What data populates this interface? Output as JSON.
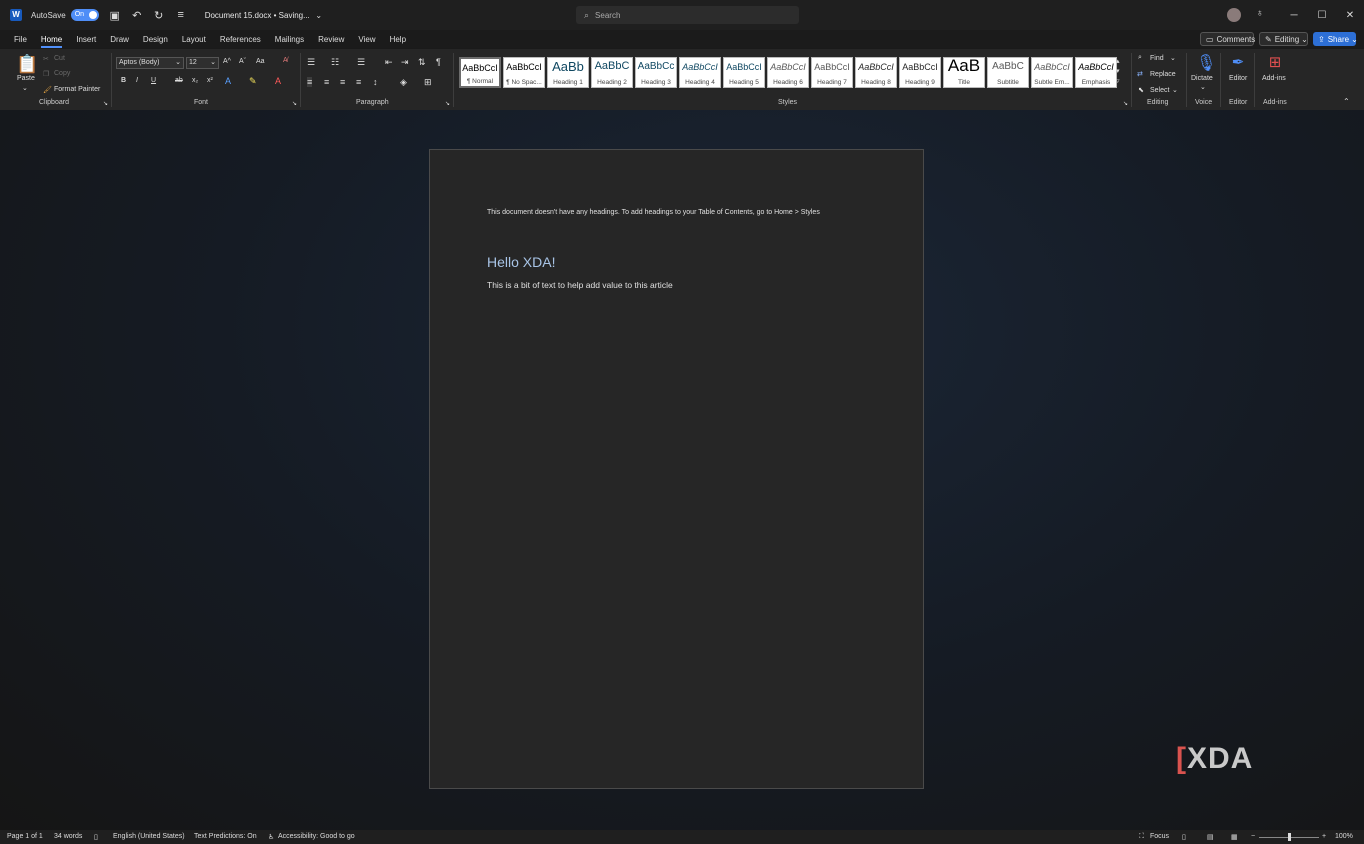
{
  "titlebar": {
    "app_icon": "word-icon",
    "autosave_label": "AutoSave",
    "autosave_state": "On",
    "doc_title": "Document 15.docx • Saving...",
    "search_placeholder": "Search",
    "window_controls": [
      "minimize-icon",
      "maximize-icon",
      "close-icon"
    ]
  },
  "tabs": [
    "File",
    "Home",
    "Insert",
    "Draw",
    "Design",
    "Layout",
    "References",
    "Mailings",
    "Review",
    "View",
    "Help"
  ],
  "active_tab": "Home",
  "top_right": {
    "comments_label": "Comments",
    "editing_label": "Editing",
    "share_label": "Share"
  },
  "ribbon": {
    "clipboard": {
      "label": "Clipboard",
      "paste": "Paste",
      "cut": "Cut",
      "copy": "Copy",
      "format_painter": "Format Painter"
    },
    "font": {
      "label": "Font",
      "font_name": "Aptos (Body)",
      "font_size": "12",
      "change_case": "Aa",
      "bold": "B",
      "italic": "I",
      "underline": "U",
      "strike": "ab",
      "subscript": "x₂",
      "superscript": "x²",
      "grow": "A^",
      "shrink": "Aˇ"
    },
    "paragraph": {
      "label": "Paragraph",
      "pilcrow": "¶"
    },
    "styles": {
      "label": "Styles",
      "items": [
        {
          "sample": "AaBbCcI",
          "name": "¶ Normal"
        },
        {
          "sample": "AaBbCcI",
          "name": "¶ No Spac..."
        },
        {
          "sample": "AaBb",
          "name": "Heading 1"
        },
        {
          "sample": "AaBbC",
          "name": "Heading 2"
        },
        {
          "sample": "AaBbCc",
          "name": "Heading 3"
        },
        {
          "sample": "AaBbCcI",
          "name": "Heading 4"
        },
        {
          "sample": "AaBbCcI",
          "name": "Heading 5"
        },
        {
          "sample": "AaBbCcI",
          "name": "Heading 6"
        },
        {
          "sample": "AaBbCcI",
          "name": "Heading 7"
        },
        {
          "sample": "AaBbCcI",
          "name": "Heading 8"
        },
        {
          "sample": "AaBbCcI",
          "name": "Heading 9"
        },
        {
          "sample": "AaB",
          "name": "Title"
        },
        {
          "sample": "AaBbC",
          "name": "Subtitle"
        },
        {
          "sample": "AaBbCcI",
          "name": "Subtle Em..."
        },
        {
          "sample": "AaBbCcI",
          "name": "Emphasis"
        }
      ]
    },
    "editing": {
      "label": "Editing",
      "find": "Find",
      "replace": "Replace",
      "select": "Select"
    },
    "voice": {
      "label": "Voice",
      "dictate": "Dictate"
    },
    "editor": {
      "label": "Editor",
      "editor": "Editor"
    },
    "addins": {
      "label": "Add-ins",
      "addins": "Add-ins"
    }
  },
  "document": {
    "toc_note": "This document doesn't have any headings. To add headings to your Table of Contents, go to Home > Styles",
    "heading": "Hello XDA!",
    "body": "This is a bit of text to help add value to this article"
  },
  "watermark": {
    "text": "XDA"
  },
  "statusbar": {
    "page": "Page 1 of 1",
    "words": "34 words",
    "language": "English (United States)",
    "predictions": "Text Predictions: On",
    "accessibility": "Accessibility: Good to go",
    "focus": "Focus",
    "zoom": "100%",
    "zoom_minus": "−",
    "zoom_plus": "+"
  },
  "colors": {
    "accent": "#4f8ef7",
    "heading": "#a8c4e6",
    "page_bg": "#262626"
  }
}
